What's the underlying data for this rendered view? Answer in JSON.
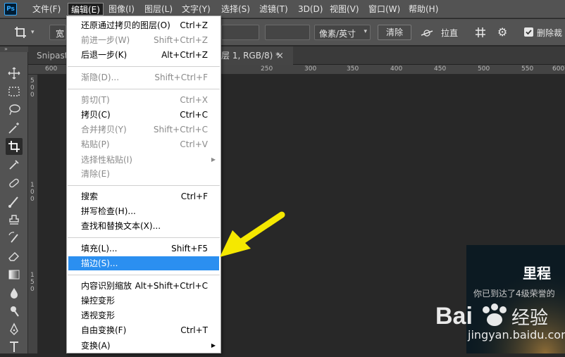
{
  "app": {
    "logo_text": "Ps"
  },
  "menubar": {
    "items": [
      "文件(F)",
      "编辑(E)",
      "图像(I)",
      "图层(L)",
      "文字(Y)",
      "选择(S)",
      "滤镜(T)",
      "3D(D)",
      "视图(V)",
      "窗口(W)",
      "帮助(H)"
    ],
    "active_index": 1
  },
  "options_bar": {
    "width_label": "宽",
    "resolution_unit": "像素/英寸",
    "clear_button": "清除",
    "straighten_label": "拉直",
    "delete_cropped_label": "删除裁",
    "delete_cropped_checked": true
  },
  "tabs": [
    {
      "label": "Snipaste"
    },
    {
      "label": "层 1, RGB/8) *"
    }
  ],
  "tab_close": "×",
  "ruler": {
    "top": [
      "600",
      "250",
      "300",
      "350",
      "400",
      "450",
      "500",
      "550",
      "600"
    ],
    "left": [
      "5",
      "0",
      "0",
      "1",
      "0",
      "0",
      "1",
      "5",
      "0"
    ]
  },
  "image_preview": {
    "title": "里程",
    "subtitle": "你已到达了4级荣誉的"
  },
  "edit_menu": {
    "items": [
      {
        "label": "还原通过拷贝的图层(O)",
        "shortcut": "Ctrl+Z",
        "enabled": true
      },
      {
        "label": "前进一步(W)",
        "shortcut": "Shift+Ctrl+Z",
        "enabled": false
      },
      {
        "label": "后退一步(K)",
        "shortcut": "Alt+Ctrl+Z",
        "enabled": true
      },
      {
        "label": "渐隐(D)...",
        "shortcut": "Shift+Ctrl+F",
        "enabled": false
      },
      {
        "label": "剪切(T)",
        "shortcut": "Ctrl+X",
        "enabled": false
      },
      {
        "label": "拷贝(C)",
        "shortcut": "Ctrl+C",
        "enabled": true
      },
      {
        "label": "合并拷贝(Y)",
        "shortcut": "Shift+Ctrl+C",
        "enabled": false
      },
      {
        "label": "粘贴(P)",
        "shortcut": "Ctrl+V",
        "enabled": false
      },
      {
        "label": "选择性粘贴(I)",
        "shortcut": "",
        "enabled": false,
        "submenu": true
      },
      {
        "label": "清除(E)",
        "shortcut": "",
        "enabled": false
      },
      {
        "label": "搜索",
        "shortcut": "Ctrl+F",
        "enabled": true
      },
      {
        "label": "拼写检查(H)...",
        "shortcut": "",
        "enabled": true
      },
      {
        "label": "查找和替换文本(X)...",
        "shortcut": "",
        "enabled": true
      },
      {
        "label": "填充(L)...",
        "shortcut": "Shift+F5",
        "enabled": true
      },
      {
        "label": "描边(S)...",
        "shortcut": "",
        "enabled": true,
        "highlighted": true
      },
      {
        "label": "内容识别缩放",
        "shortcut": "Alt+Shift+Ctrl+C",
        "enabled": true
      },
      {
        "label": "操控变形",
        "shortcut": "",
        "enabled": true
      },
      {
        "label": "透视变形",
        "shortcut": "",
        "enabled": true
      },
      {
        "label": "自由变换(F)",
        "shortcut": "Ctrl+T",
        "enabled": true
      },
      {
        "label": "变换(A)",
        "shortcut": "",
        "enabled": true,
        "submenu": true
      }
    ]
  },
  "watermark": {
    "brand": "Baidu经验",
    "url": "jingyan.baidu.com"
  },
  "colors": {
    "accent": "#2b8ff0",
    "arrow": "#f5e800"
  }
}
